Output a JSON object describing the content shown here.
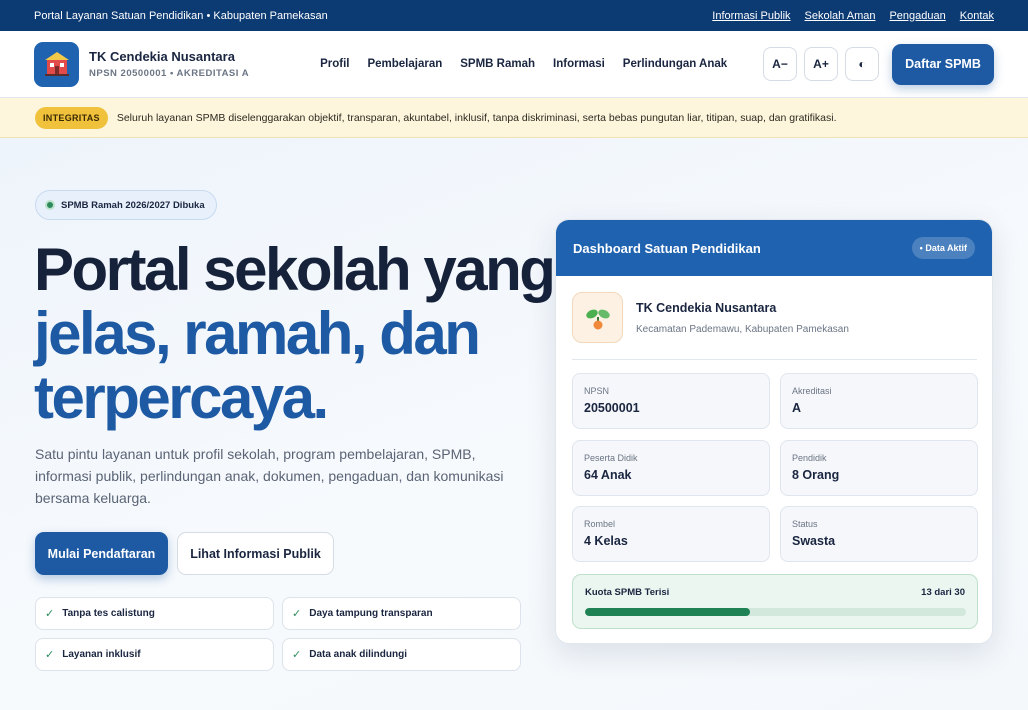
{
  "topbar": {
    "title": "Portal Layanan Satuan Pendidikan • Kabupaten Pamekasan",
    "links": [
      "Informasi Publik",
      "Sekolah Aman",
      "Pengaduan",
      "Kontak"
    ]
  },
  "header": {
    "school_name": "TK Cendekia Nusantara",
    "school_sub": "NPSN 20500001 • AKREDITASI A",
    "nav": [
      "Profil",
      "Pembelajaran",
      "SPMB Ramah",
      "Informasi",
      "Perlindungan Anak"
    ],
    "font_decrease": "A−",
    "font_increase": "A+",
    "contrast_icon": "◐",
    "cta": "Daftar SPMB"
  },
  "notice": {
    "badge": "INTEGRITAS",
    "text": "Seluruh layanan SPMB diselenggarakan objektif, transparan, akuntabel, inklusif, tanpa diskriminasi, serta bebas pungutan liar, titipan, suap, dan gratifikasi."
  },
  "hero": {
    "pill": "SPMB Ramah 2026/2027 Dibuka",
    "headline_line1": "Portal sekolah yang",
    "headline_line2": "jelas, ramah, dan",
    "headline_line3": "terpercaya.",
    "lead": "Satu pintu layanan untuk profil sekolah, program pembelajaran, SPMB, informasi publik, perlindungan anak, dokumen, pengaduan, dan komunikasi bersama keluarga.",
    "primary_button": "Mulai Pendaftaran",
    "secondary_button": "Lihat Informasi Publik",
    "features": [
      "Tanpa tes calistung",
      "Daya tampung transparan",
      "Layanan inklusif",
      "Data anak dilindungi"
    ]
  },
  "dashboard": {
    "title": "Dashboard Satuan Pendidikan",
    "tag": "• Data Aktif",
    "school_name": "TK Cendekia Nusantara",
    "school_location": "Kecamatan Pademawu, Kabupaten Pamekasan",
    "stats": [
      {
        "label": "NPSN",
        "value": "20500001"
      },
      {
        "label": "Akreditasi",
        "value": "A"
      },
      {
        "label": "Peserta Didik",
        "value": "64 Anak"
      },
      {
        "label": "Pendidik",
        "value": "8 Orang"
      },
      {
        "label": "Rombel",
        "value": "4 Kelas"
      },
      {
        "label": "Status",
        "value": "Swasta"
      }
    ],
    "quota_label": "Kuota SPMB Terisi",
    "quota_text": "13 dari 30",
    "quota_filled": 13,
    "quota_total": 30
  },
  "colors": {
    "primary": "#1e5aa3",
    "topbar": "#0c3a73",
    "success": "#1f8255",
    "warning": "#f0c23c"
  }
}
